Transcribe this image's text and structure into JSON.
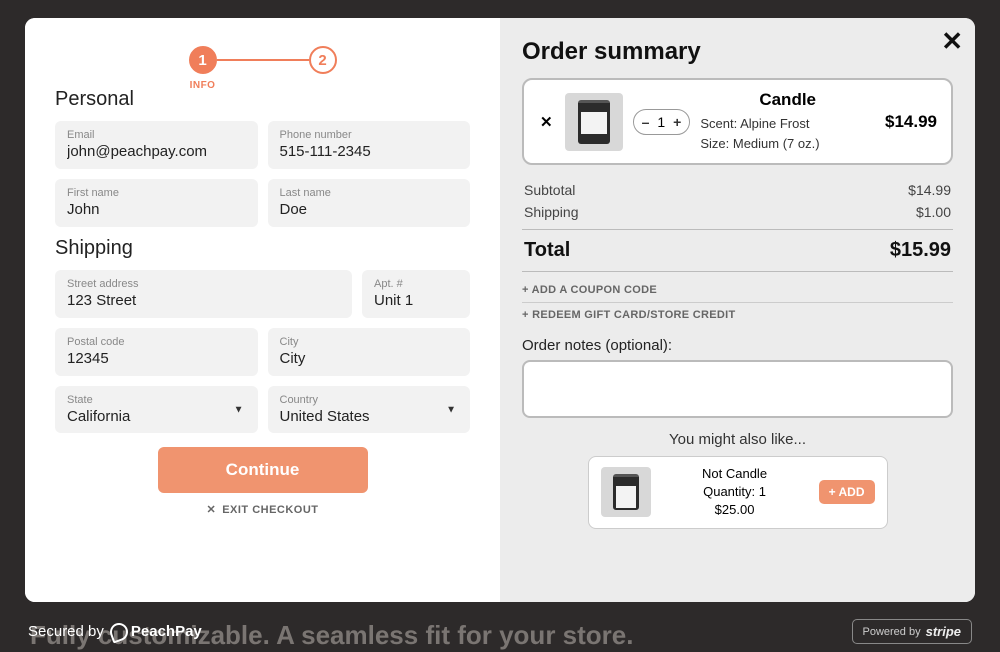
{
  "backdrop_text": "Fully customizable. A seamless fit for your store.",
  "steps": {
    "step1": "1",
    "step2": "2",
    "label1": "INFO"
  },
  "personal": {
    "title": "Personal",
    "email_label": "Email",
    "email_value": "john@peachpay.com",
    "phone_label": "Phone number",
    "phone_value": "515-111-2345",
    "first_label": "First name",
    "first_value": "John",
    "last_label": "Last name",
    "last_value": "Doe"
  },
  "shipping": {
    "title": "Shipping",
    "street_label": "Street address",
    "street_value": "123 Street",
    "apt_label": "Apt. #",
    "apt_value": "Unit 1",
    "postal_label": "Postal code",
    "postal_value": "12345",
    "city_label": "City",
    "city_value": "City",
    "state_label": "State",
    "state_value": "California",
    "country_label": "Country",
    "country_value": "United States"
  },
  "buttons": {
    "continue": "Continue",
    "exit": "EXIT CHECKOUT"
  },
  "order": {
    "title": "Order summary",
    "item": {
      "name": "Candle",
      "qty": "1",
      "scent": "Scent: Alpine Frost",
      "size": "Size: Medium (7 oz.)",
      "price": "$14.99"
    },
    "subtotal_label": "Subtotal",
    "subtotal_value": "$14.99",
    "shipping_label": "Shipping",
    "shipping_value": "$1.00",
    "total_label": "Total",
    "total_value": "$15.99",
    "coupon_link": "+ ADD A COUPON CODE",
    "giftcard_link": "+ REDEEM GIFT CARD/STORE CREDIT",
    "notes_label": "Order notes (optional):"
  },
  "recommend": {
    "title": "You might also like...",
    "item_name": "Not Candle",
    "item_qty": "Quantity: 1",
    "item_price": "$25.00",
    "add": "+ ADD"
  },
  "footer": {
    "secured": "Secured by",
    "brand": "PeachPay",
    "powered": "Powered by",
    "stripe": "stripe"
  }
}
